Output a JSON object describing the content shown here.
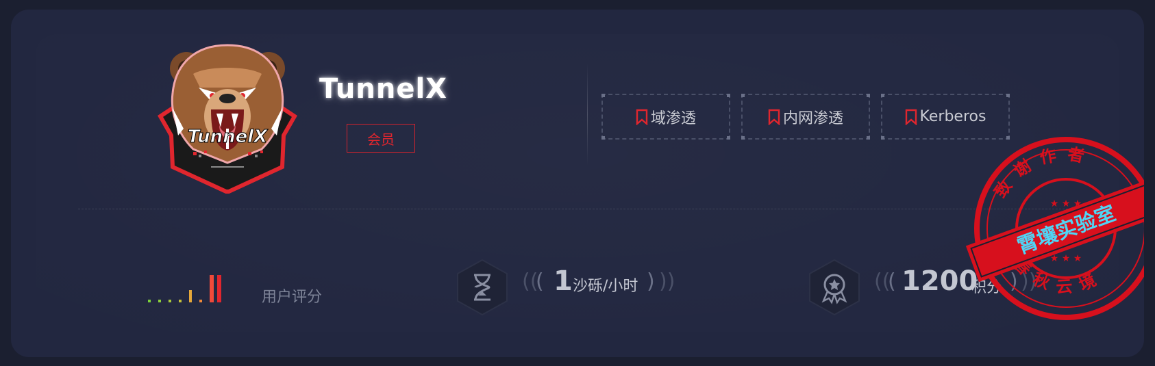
{
  "profile": {
    "username": "TunnelX",
    "logo_text": "TunnelX",
    "member_label": "会员"
  },
  "tags": [
    {
      "label": "域渗透",
      "icon": "bookmark-icon"
    },
    {
      "label": "内网渗透",
      "icon": "bookmark-icon"
    },
    {
      "label": "Kerberos",
      "icon": "bookmark-icon"
    }
  ],
  "stats": {
    "rating_label": "用户评分",
    "rating_level": 7,
    "rating_max": 8,
    "sand_value": "1",
    "sand_unit": "沙砾/小时",
    "points_value": "1200",
    "points_unit": "积分"
  },
  "stamp": {
    "top_text": "致谢作者",
    "center_text": "霄壤实验室",
    "bottom_text": "春秋云境"
  },
  "colors": {
    "accent_red": "#e0262e",
    "stamp_red": "#d7101d",
    "stamp_text_cyan": "#4fd5f5",
    "card_bg": "#222740",
    "page_bg": "#1b1f30"
  }
}
